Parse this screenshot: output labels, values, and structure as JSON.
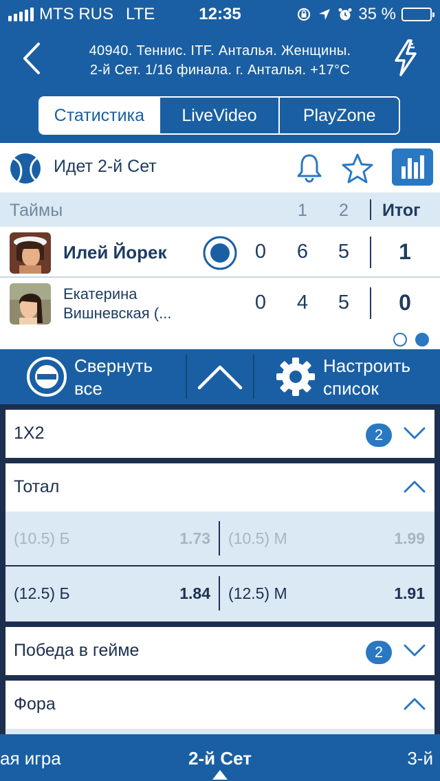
{
  "status_bar": {
    "carrier": "MTS RUS",
    "network": "LTE",
    "time": "12:35",
    "battery_percent": "35 %",
    "battery_level": 0.35,
    "icons": [
      "orientation-lock-icon",
      "location-icon",
      "alarm-icon"
    ]
  },
  "header": {
    "title_line1": "40940. Теннис. ITF. Анталья. Женщины.",
    "title_line2": "2-й  Сет. 1/16 финала. г. Анталья. +17°С",
    "back_icon": "chevron-left-icon",
    "action_icon": "lightning-icon"
  },
  "tabs": [
    {
      "label": "Статистика",
      "active": true
    },
    {
      "label": "LiveVideo",
      "active": false
    },
    {
      "label": "PlayZone",
      "active": false
    }
  ],
  "match": {
    "status": "Идет 2-й  Сет",
    "columns_label": "Таймы",
    "col1": "1",
    "col2": "2",
    "total_label": "Итог",
    "players": [
      {
        "name": "Илей Йорек",
        "serving": true,
        "game": "0",
        "set1": "6",
        "set2": "5",
        "total": "1"
      },
      {
        "name_line1": "Екатерина",
        "name_line2": "Вишневская (...",
        "serving": false,
        "game": "0",
        "set1": "4",
        "set2": "5",
        "total": "0"
      }
    ]
  },
  "actions": {
    "collapse_line1": "Свернуть",
    "collapse_line2": "все",
    "configure_line1": "Настроить",
    "configure_line2": "список"
  },
  "markets": {
    "m1x2": {
      "title": "1X2",
      "count": "2",
      "expanded": false
    },
    "total": {
      "title": "Тотал",
      "expanded": true,
      "rows": [
        {
          "over_label": "(10.5) Б",
          "over_odds": "1.73",
          "under_label": "(10.5) М",
          "under_odds": "1.99",
          "disabled": true
        },
        {
          "over_label": "(12.5) Б",
          "over_odds": "1.84",
          "under_label": "(12.5) М",
          "under_odds": "1.91",
          "disabled": false
        }
      ]
    },
    "game_win": {
      "title": "Победа в гейме",
      "count": "2",
      "expanded": false
    },
    "handicap": {
      "title": "Фора",
      "expanded": true
    }
  },
  "set_nav": {
    "prev": "ая игра",
    "current": "2-й  Сет",
    "next": "3-й"
  },
  "colors": {
    "brand_blue": "#1a5fa3",
    "accent_blue": "#2a78c2",
    "light_row": "#dbe9f5",
    "dark_bg": "#1d2f4f",
    "battery_yellow": "#f3c318"
  }
}
